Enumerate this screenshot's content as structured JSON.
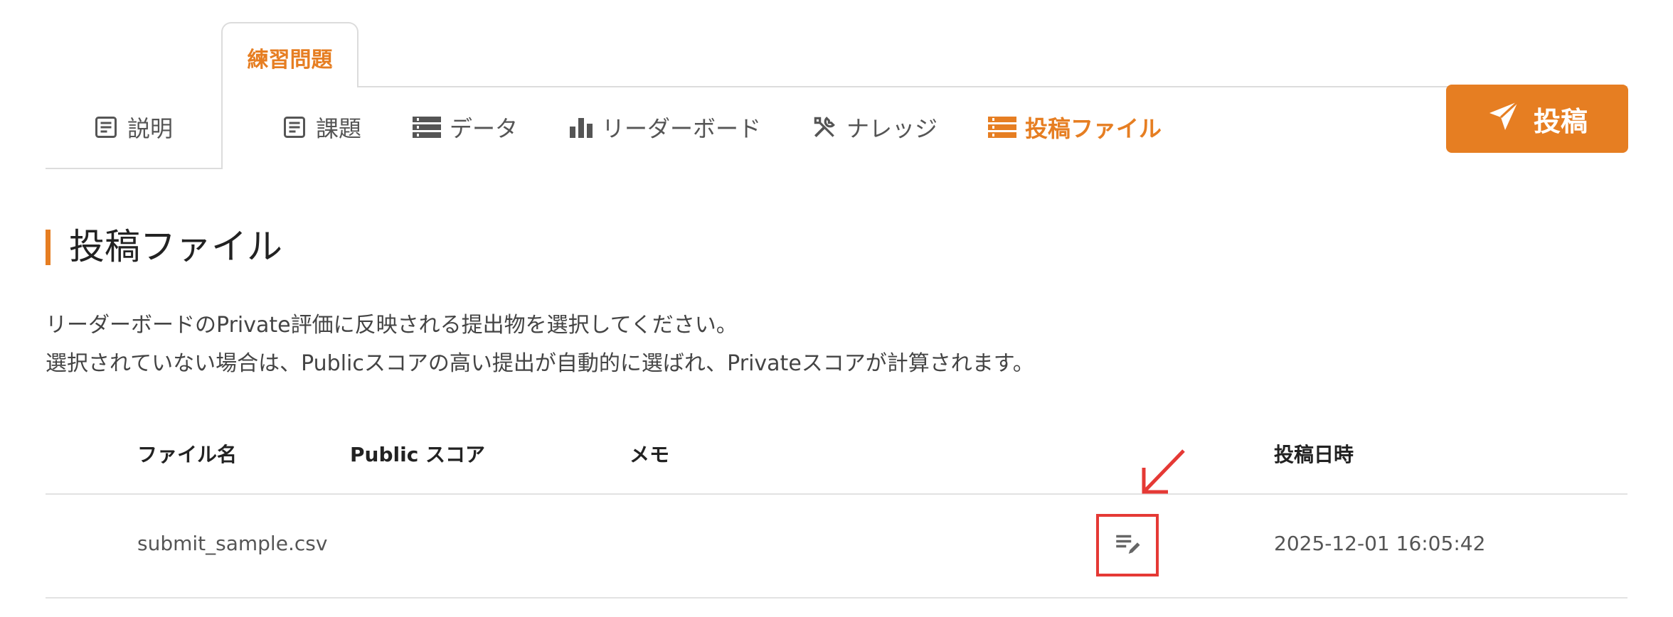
{
  "top_tab": {
    "label": "練習問題"
  },
  "nav": {
    "description": "説明",
    "task": "課題",
    "data": "データ",
    "leaderboard": "リーダーボード",
    "knowledge": "ナレッジ",
    "submissions": "投稿ファイル",
    "active": "submissions"
  },
  "post_button": {
    "label": "投稿"
  },
  "section": {
    "title": "投稿ファイル",
    "desc_line1": "リーダーボードのPrivate評価に反映される提出物を選択してください。",
    "desc_line2": "選択されていない場合は、Publicスコアの高い提出が自動的に選ばれ、Privateスコアが計算されます。"
  },
  "table": {
    "headers": {
      "file": "ファイル名",
      "score": "Public スコア",
      "memo": "メモ",
      "date": "投稿日時"
    },
    "rows": [
      {
        "file": "submit_sample.csv",
        "score": "",
        "memo": "",
        "date": "2025-12-01 16:05:42"
      }
    ]
  },
  "colors": {
    "accent": "#e67e22",
    "highlight": "#e53935"
  },
  "icons": {
    "nav": [
      "document-icon",
      "document-icon",
      "table-rows-icon",
      "bar-chart-icon",
      "tools-icon",
      "table-rows-icon"
    ],
    "post": "paper-plane-icon",
    "memo_edit": "edit-note-icon",
    "annotation": "arrow-down-left-icon"
  }
}
